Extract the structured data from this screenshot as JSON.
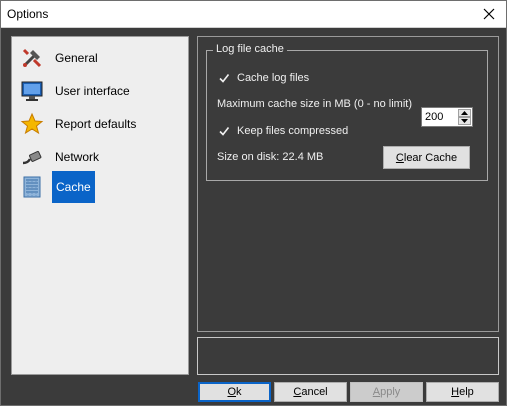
{
  "window": {
    "title": "Options"
  },
  "nav": {
    "items": [
      {
        "label": "General",
        "icon": "tools-icon"
      },
      {
        "label": "User interface",
        "icon": "monitor-icon"
      },
      {
        "label": "Report defaults",
        "icon": "star-icon"
      },
      {
        "label": "Network",
        "icon": "network-cable-icon"
      },
      {
        "label": "Cache",
        "icon": "cache-icon",
        "selected": true
      }
    ]
  },
  "cache": {
    "group_title": "Log file cache",
    "cache_log_files_label": "Cache log files",
    "cache_log_files_checked": true,
    "max_cache_label": "Maximum cache size in MB (0 - no limit)",
    "max_cache_value": "200",
    "keep_compressed_label": "Keep files compressed",
    "keep_compressed_checked": true,
    "size_on_disk": "Size on disk: 22.4 MB",
    "clear_button": {
      "prefix": "",
      "underline": "C",
      "rest": "lear Cache"
    }
  },
  "buttons": {
    "ok": {
      "underline": "O",
      "rest": "k"
    },
    "cancel": {
      "prefix": "",
      "underline": "C",
      "rest": "ancel"
    },
    "apply": {
      "underline": "A",
      "rest": "pply"
    },
    "help": {
      "underline": "H",
      "rest": "elp"
    }
  },
  "colors": {
    "accent": "#0a64c8",
    "background": "#3b3b3b",
    "nav_background": "#eeeeee"
  }
}
